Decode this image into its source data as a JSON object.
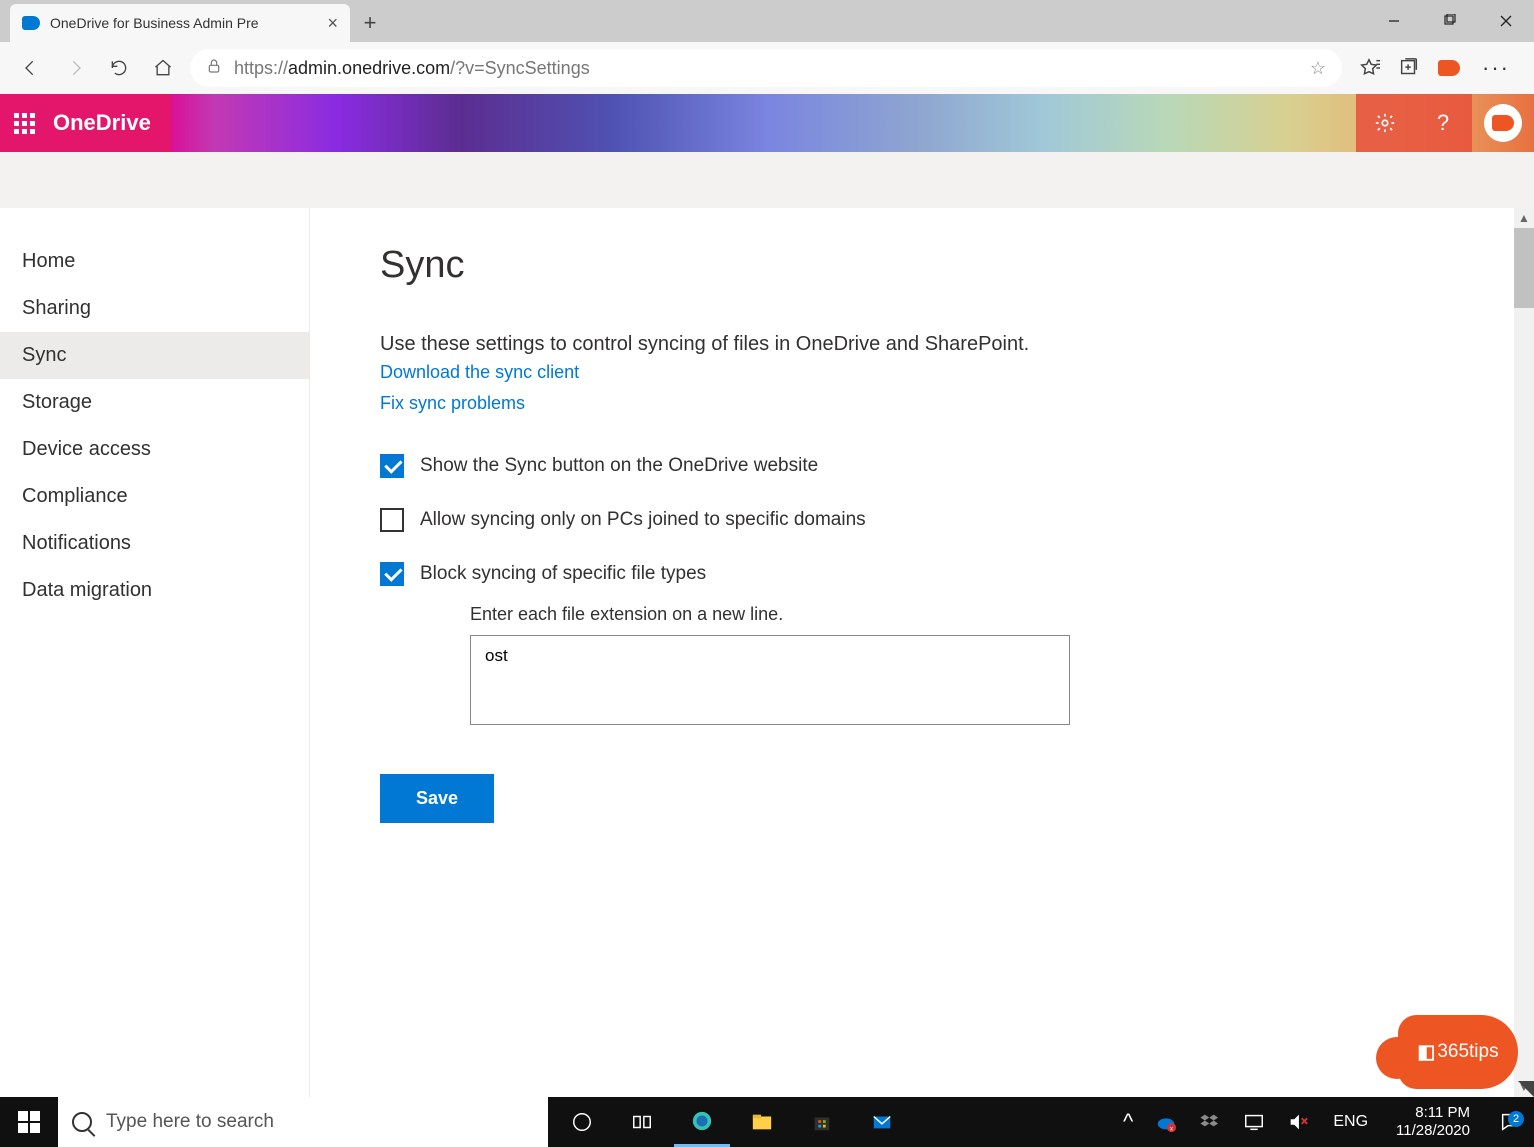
{
  "browser": {
    "tab_title": "OneDrive for Business Admin Pre",
    "url_proto": "https://",
    "url_domain": "admin.onedrive.com",
    "url_path": "/?v=SyncSettings"
  },
  "header": {
    "app": "OneDrive"
  },
  "sidebar": {
    "items": [
      {
        "label": "Home"
      },
      {
        "label": "Sharing"
      },
      {
        "label": "Sync"
      },
      {
        "label": "Storage"
      },
      {
        "label": "Device access"
      },
      {
        "label": "Compliance"
      },
      {
        "label": "Notifications"
      },
      {
        "label": "Data migration"
      }
    ],
    "active_index": 2
  },
  "content": {
    "title": "Sync",
    "description": "Use these settings to control syncing of files in OneDrive and SharePoint.",
    "link_download": "Download the sync client",
    "link_fix": "Fix sync problems",
    "checkbox_show_sync": {
      "checked": true,
      "label": "Show the Sync button on the OneDrive website"
    },
    "checkbox_domains": {
      "checked": false,
      "label": "Allow syncing only on PCs joined to specific domains"
    },
    "checkbox_block": {
      "checked": true,
      "label": "Block syncing of specific file types"
    },
    "ext_label": "Enter each file extension on a new line.",
    "ext_value": "ost",
    "save": "Save"
  },
  "badge": {
    "text": "365tips"
  },
  "taskbar": {
    "search_placeholder": "Type here to search",
    "lang": "ENG",
    "time": "8:11 PM",
    "date": "11/28/2020",
    "notif_count": "2"
  }
}
